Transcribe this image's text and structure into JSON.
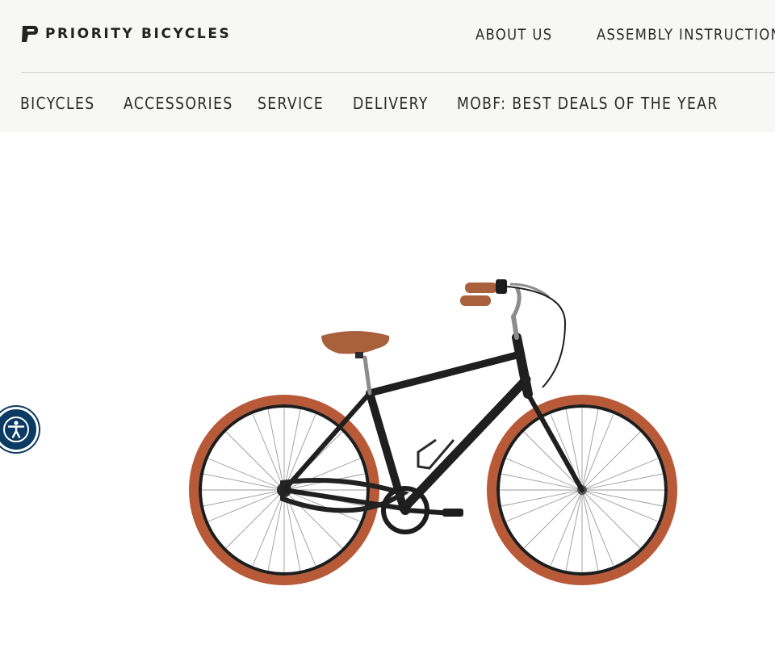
{
  "brand": {
    "name": "PRIORITY BICYCLES",
    "logo_icon": "priority-p-logo-icon"
  },
  "top_nav": {
    "items": [
      {
        "label": "ABOUT US"
      },
      {
        "label": "ASSEMBLY INSTRUCTIONS"
      }
    ]
  },
  "main_nav": {
    "items": [
      {
        "label": "BICYCLES"
      },
      {
        "label": "ACCESSORIES"
      },
      {
        "label": "SERVICE"
      },
      {
        "label": "DELIVERY"
      },
      {
        "label": "MOBF: BEST DEALS OF THE YEAR"
      }
    ]
  },
  "accessibility_widget": {
    "icon": "accessibility-person-icon",
    "color": "#0b3a63"
  },
  "product": {
    "image": "black-city-bicycle-brown-tires-image"
  },
  "colors": {
    "header_bg": "#f7f7f5",
    "text": "#2a2a2a",
    "tire": "#b85a38",
    "frame": "#1f1f1f",
    "saddle": "#a8613a"
  }
}
